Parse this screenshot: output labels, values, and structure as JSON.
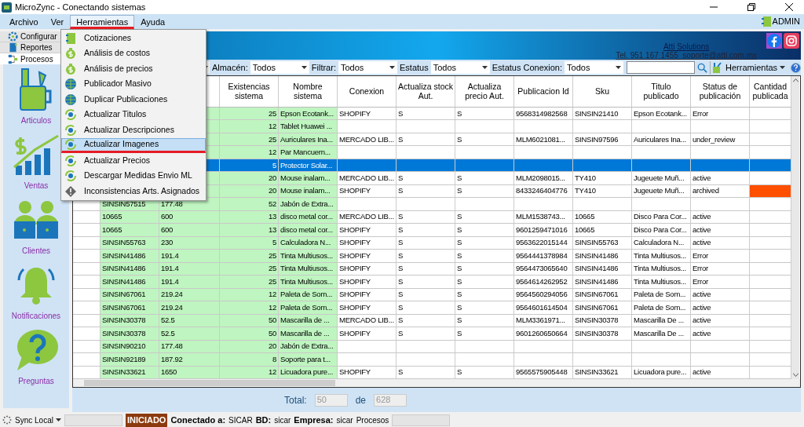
{
  "window": {
    "title": "MicroZync - Conectando sistemas"
  },
  "menu_bar": [
    {
      "label": "Archivo",
      "selected": false
    },
    {
      "label": "Ver",
      "selected": false
    },
    {
      "label": "Herramientas",
      "selected": true
    },
    {
      "label": "Ayuda",
      "selected": false
    }
  ],
  "user": "ADMIN",
  "side_tabs": [
    {
      "label": "Configurar",
      "kind": "gear",
      "selected": false
    },
    {
      "label": "Reportes",
      "kind": "book",
      "selected": false
    },
    {
      "label": "Procesos",
      "kind": "flow",
      "selected": true
    }
  ],
  "modules": [
    {
      "label": "Articulos",
      "kind": "articulos"
    },
    {
      "label": "Ventas",
      "kind": "ventas"
    },
    {
      "label": "Clientes",
      "kind": "clientes"
    },
    {
      "label": "Notificaciones",
      "kind": "notificaciones"
    },
    {
      "label": "Preguntas",
      "kind": "preguntas"
    }
  ],
  "banner": {
    "company": "Atti Solutions",
    "contact": "Tel. 951 167 1455  soporte@atti.com.mx"
  },
  "filters": [
    {
      "label": "Almacén:",
      "value": "Todos"
    },
    {
      "label": "Filtrar:",
      "value": "Todos"
    },
    {
      "label": "Estatus",
      "value": "Todos"
    },
    {
      "label": "Estatus Conexion:",
      "value": "Todos"
    }
  ],
  "tools_button": "Herramientas",
  "dropdown": {
    "items": [
      {
        "label": "Cotizaciones",
        "kind": "notebook",
        "selected": false
      },
      {
        "label": "Análisis de costos",
        "kind": "money",
        "selected": false
      },
      {
        "label": "Análisis de precios",
        "kind": "money",
        "selected": false
      },
      {
        "label": "Publicador Masivo",
        "kind": "globe",
        "selected": false
      },
      {
        "label": "Duplicar Publicaciones",
        "kind": "globe",
        "selected": false
      },
      {
        "label": "Actualizar Titulos",
        "kind": "refresh",
        "selected": false
      },
      {
        "label": "Actualizar Descripciones",
        "kind": "refresh",
        "selected": false
      },
      {
        "label": "Actualizar Imagenes",
        "kind": "refresh",
        "selected": true
      },
      {
        "label": "Actualizar Precios",
        "kind": "refresh",
        "selected": false
      },
      {
        "label": "Descargar Medidas Envio ML",
        "kind": "refresh",
        "selected": false
      },
      {
        "label": "Inconsistencias Arts. Asignados",
        "kind": "warning",
        "selected": false
      }
    ]
  },
  "table": {
    "columns": [
      "Existencias sistema",
      "Nombre sistema",
      "Conexion",
      "Actualiza stock Aut.",
      "Actualiza precio Aut.",
      "Publicacion Id",
      "Sku",
      "Titulo publicado",
      "Status de publicación",
      "Cantidad publicada"
    ],
    "rows": [
      {
        "existencias": "25",
        "nombre": "Epson Ecotank...",
        "conexion": "SHOPIFY",
        "stock_aut": "S",
        "precio_aut": "S",
        "publicacion_id": "9568314982568",
        "sku": "SINSIN21410",
        "titulo": "Epson Ecotank...",
        "status": "Error",
        "selected": false
      },
      {
        "existencias": "12",
        "nombre": "Tablet Huawei ...",
        "selected": false
      },
      {
        "existencias": "25",
        "nombre": "Auriculares Ina...",
        "conexion": "MERCADO LIB...",
        "stock_aut": "S",
        "precio_aut": "S",
        "publicacion_id": "MLM6021081...",
        "sku": "SINSIN97596",
        "titulo": "Auriculares Ina...",
        "status": "under_review",
        "selected": false
      },
      {
        "existencias": "12",
        "nombre": "Par Mancuern...",
        "selected": false
      },
      {
        "existencias": "5",
        "nombre": "Protector Solar...",
        "selected": true
      },
      {
        "existencias": "20",
        "nombre": "Mouse inalam...",
        "conexion": "MERCADO LIB...",
        "stock_aut": "S",
        "precio_aut": "S",
        "publicacion_id": "MLM2098015...",
        "sku": "TY410",
        "titulo": "Jugeuete Muñ...",
        "status": "active",
        "selected": false
      },
      {
        "existencias": "20",
        "nombre": "Mouse inalam...",
        "conexion": "SHOPIFY",
        "stock_aut": "S",
        "precio_aut": "S",
        "publicacion_id": "8433246404776",
        "sku": "TY410",
        "titulo": "Jugeuete Muñ...",
        "status": "archived",
        "color": "#ff4f00",
        "selected": false
      },
      {
        "column_1": "SINSIN57515",
        "column_2": "177.48",
        "existencias": "52",
        "nombre": "Jabón de Extra...",
        "selected": false
      },
      {
        "column_1": "10665",
        "column_2": "600",
        "existencias": "13",
        "nombre": "disco metal cor...",
        "conexion": "MERCADO LIB...",
        "stock_aut": "S",
        "precio_aut": "S",
        "publicacion_id": "MLM1538743...",
        "sku": "10665",
        "titulo": "Disco Para Cor...",
        "status": "active",
        "selected": false
      },
      {
        "column_1": "10665",
        "column_2": "600",
        "existencias": "13",
        "nombre": "disco metal cor...",
        "conexion": "SHOPIFY",
        "stock_aut": "S",
        "precio_aut": "S",
        "publicacion_id": "9601259471016",
        "sku": "10665",
        "titulo": "Disco Para Cor...",
        "status": "active",
        "selected": false
      },
      {
        "column_1": "SINSIN55763",
        "column_2": "230",
        "existencias": "5",
        "nombre": "Calculadora N...",
        "conexion": "SHOPIFY",
        "stock_aut": "S",
        "precio_aut": "S",
        "publicacion_id": "9563622015144",
        "sku": "SINSIN55763",
        "titulo": "Calculadora N...",
        "status": "active",
        "selected": false
      },
      {
        "column_1": "SINSIN41486",
        "column_2": "191.4",
        "existencias": "25",
        "nombre": "Tinta Multiusos...",
        "conexion": "SHOPIFY",
        "stock_aut": "S",
        "precio_aut": "S",
        "publicacion_id": "9564441378984",
        "sku": "SINSIN41486",
        "titulo": "Tinta Multiusos...",
        "status": "Error",
        "selected": false
      },
      {
        "column_1": "SINSIN41486",
        "column_2": "191.4",
        "existencias": "25",
        "nombre": "Tinta Multiusos...",
        "conexion": "SHOPIFY",
        "stock_aut": "S",
        "precio_aut": "S",
        "publicacion_id": "9564473065640",
        "sku": "SINSIN41486",
        "titulo": "Tinta Multiusos...",
        "status": "Error",
        "selected": false
      },
      {
        "column_1": "SINSIN41486",
        "column_2": "191.4",
        "existencias": "25",
        "nombre": "Tinta Multiusos...",
        "conexion": "SHOPIFY",
        "stock_aut": "S",
        "precio_aut": "S",
        "publicacion_id": "9564614262952",
        "sku": "SINSIN41486",
        "titulo": "Tinta Multiusos...",
        "status": "Error",
        "selected": false
      },
      {
        "column_1": "SINSIN67061",
        "column_2": "219.24",
        "existencias": "12",
        "nombre": "Paleta de Som...",
        "conexion": "SHOPIFY",
        "stock_aut": "S",
        "precio_aut": "S",
        "publicacion_id": "9564560294056",
        "sku": "SINSIN67061",
        "titulo": "Paleta de Som...",
        "status": "active",
        "selected": false
      },
      {
        "column_1": "SINSIN67061",
        "column_2": "219.24",
        "existencias": "12",
        "nombre": "Paleta de Som...",
        "conexion": "SHOPIFY",
        "stock_aut": "S",
        "precio_aut": "S",
        "publicacion_id": "9564601614504",
        "sku": "SINSIN67061",
        "titulo": "Paleta de Som...",
        "status": "active",
        "selected": false
      },
      {
        "column_1": "SINSIN30378",
        "column_2": "52.5",
        "existencias": "50",
        "nombre": "Mascarilla de ...",
        "conexion": "MERCADO LIB...",
        "stock_aut": "S",
        "precio_aut": "S",
        "publicacion_id": "MLM3361971...",
        "sku": "SINSIN30378",
        "titulo": "Mascarilla De ...",
        "status": "active",
        "selected": false
      },
      {
        "column_1": "SINSIN30378",
        "column_2": "52.5",
        "existencias": "50",
        "nombre": "Mascarilla de ...",
        "conexion": "SHOPIFY",
        "stock_aut": "S",
        "precio_aut": "S",
        "publicacion_id": "9601260650664",
        "sku": "SINSIN30378",
        "titulo": "Mascarilla De ...",
        "status": "active",
        "selected": false
      },
      {
        "column_1": "SINSIN90210",
        "column_2": "177.48",
        "existencias": "20",
        "nombre": "Jabón de Extra...",
        "selected": false
      },
      {
        "column_1": "SINSIN92189",
        "column_2": "187.92",
        "existencias": "8",
        "nombre": "Soporte para t...",
        "selected": false
      },
      {
        "column_1": "SINSIN33621",
        "column_2": "1650",
        "existencias": "12",
        "nombre": "Licuadora pure...",
        "conexion": "SHOPIFY",
        "stock_aut": "S",
        "precio_aut": "S",
        "publicacion_id": "9565575905448",
        "sku": "SINSIN33621",
        "titulo": "Licuadora pure...",
        "status": "active",
        "selected": false
      }
    ]
  },
  "totals": {
    "label": "Total:",
    "shown": "50",
    "separator": "de",
    "total": "628"
  },
  "status_bar": {
    "sync": "Sync Local",
    "state": "INICIADO",
    "items": [
      {
        "label": "Conectado a:",
        "value": "SICAR"
      },
      {
        "label": "BD:",
        "value": "sicar"
      },
      {
        "label": "Empresa:",
        "value": "sicar"
      }
    ],
    "section": "Procesos"
  }
}
